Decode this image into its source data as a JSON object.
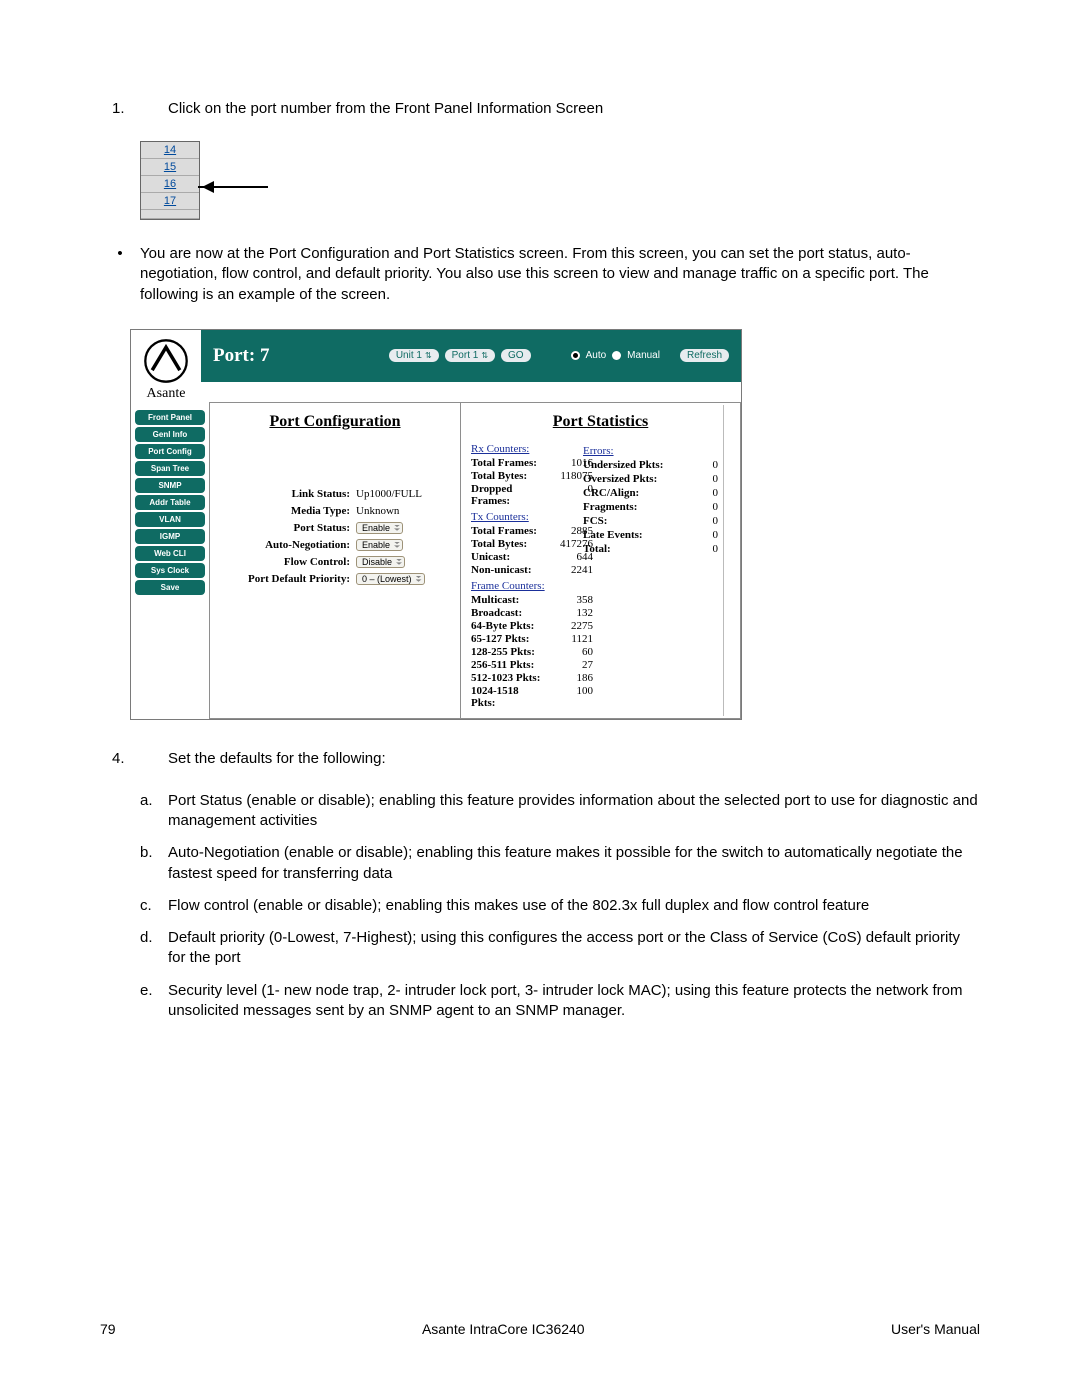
{
  "step1_num": "1.",
  "step1_text": "Click on the port number from the Front Panel Information Screen",
  "port_rows": [
    "14",
    "15",
    "16",
    "17"
  ],
  "bullet_text": "You are now at the Port Configuration and Port Statistics screen. From this screen, you can set the port status, auto-negotiation, flow control, and default priority. You also use this screen to view and manage traffic on a specific port. The following is an example of the screen.",
  "screenshot": {
    "title": "Port: 7",
    "unit_sel": "Unit 1",
    "port_sel": "Port 1",
    "go": "GO",
    "mode_auto": "Auto",
    "mode_manual": "Manual",
    "refresh": "Refresh",
    "brand": "Asante",
    "sidebar": [
      "Front Panel",
      "Genl Info",
      "Port Config",
      "Span Tree",
      "SNMP",
      "Addr Table",
      "VLAN",
      "IGMP",
      "Web CLI",
      "Sys Clock",
      "Save"
    ],
    "cfg_hdr": "Port Configuration",
    "stat_hdr": "Port Statistics",
    "cfg": [
      {
        "k": "Link Status:",
        "v": "Up1000/FULL"
      },
      {
        "k": "Media Type:",
        "v": "Unknown"
      },
      {
        "k": "Port Status:",
        "sel": "Enable"
      },
      {
        "k": "Auto-Negotiation:",
        "sel": "Enable"
      },
      {
        "k": "Flow Control:",
        "sel": "Disable"
      },
      {
        "k": "Port Default Priority:",
        "sel": "0 – (Lowest)"
      }
    ],
    "rx_hdr": "Rx Counters:",
    "rx": [
      {
        "k": "Total Frames:",
        "v": "1016"
      },
      {
        "k": "Total Bytes:",
        "v": "118075"
      },
      {
        "k": "Dropped Frames:",
        "v": "0"
      }
    ],
    "tx_hdr": "Tx Counters:",
    "tx": [
      {
        "k": "Total Frames:",
        "v": "2885"
      },
      {
        "k": "Total Bytes:",
        "v": "417276"
      },
      {
        "k": "Unicast:",
        "v": "644"
      },
      {
        "k": "Non-unicast:",
        "v": "2241"
      }
    ],
    "fr_hdr": "Frame Counters:",
    "fr": [
      {
        "k": "Multicast:",
        "v": "358"
      },
      {
        "k": "Broadcast:",
        "v": "132"
      },
      {
        "k": "64-Byte Pkts:",
        "v": "2275"
      },
      {
        "k": "65-127 Pkts:",
        "v": "1121"
      },
      {
        "k": "128-255 Pkts:",
        "v": "60"
      },
      {
        "k": "256-511 Pkts:",
        "v": "27"
      },
      {
        "k": "512-1023 Pkts:",
        "v": "186"
      },
      {
        "k": "1024-1518 Pkts:",
        "v": "100"
      }
    ],
    "err_hdr": "Errors:",
    "err": [
      {
        "k": "Undersized Pkts:",
        "v": "0"
      },
      {
        "k": "Oversized Pkts:",
        "v": "0"
      },
      {
        "k": "CRC/Align:",
        "v": "0"
      },
      {
        "k": "Fragments:",
        "v": "0"
      },
      {
        "k": "FCS:",
        "v": "0"
      },
      {
        "k": "Late Events:",
        "v": "0"
      },
      {
        "k": "Total:",
        "v": "0"
      }
    ]
  },
  "step4_num": "4.",
  "step4_text": "Set the defaults for the following:",
  "subs": [
    {
      "l": "a.",
      "t": "Port Status (enable or disable); enabling this feature provides information about the selected port to use for diagnostic and management activities"
    },
    {
      "l": "b.",
      "t": "Auto-Negotiation (enable or disable); enabling this feature makes it possible for the switch to automatically negotiate the fastest speed for transferring data"
    },
    {
      "l": "c.",
      "t": "Flow control (enable or disable); enabling this makes use of the 802.3x full duplex and flow control feature"
    },
    {
      "l": "d.",
      "t": "Default priority (0-Lowest, 7-Highest); using this configures the access port or the Class of Service (CoS) default priority for the port"
    },
    {
      "l": "e.",
      "t": "Security level (1- new node trap, 2- intruder lock port, 3- intruder lock MAC); using this feature protects the network from unsolicited messages sent by an SNMP agent to an SNMP manager."
    }
  ],
  "footer": {
    "page": "79",
    "center": "Asante IntraCore IC36240",
    "right": "User's Manual"
  }
}
